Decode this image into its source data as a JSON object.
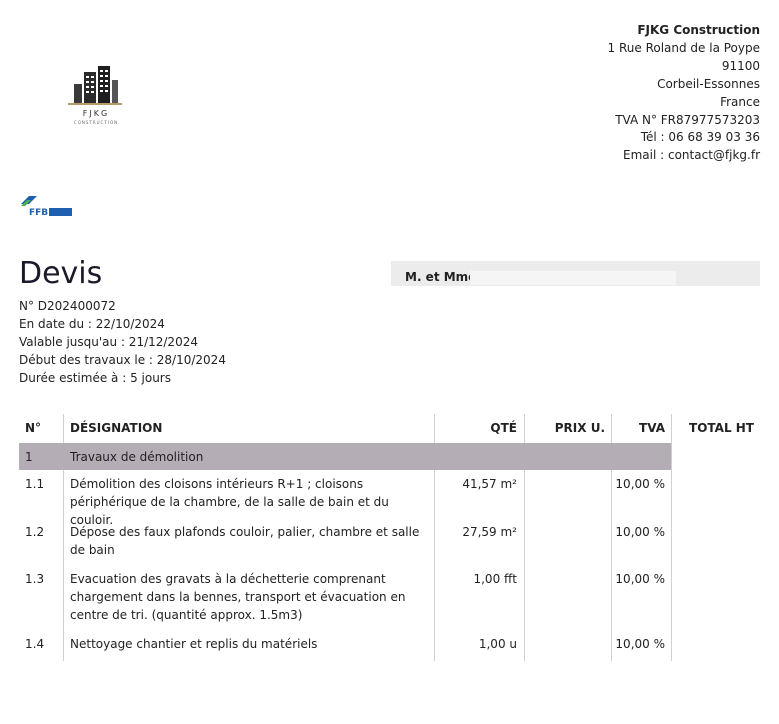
{
  "logo": {
    "name": "FJKG",
    "subtitle": "CONSTRUCTION"
  },
  "company": {
    "name": "FJKG Construction",
    "address": "1 Rue Roland de la Poype",
    "postcode": "91100",
    "city": "Corbeil-Essonnes",
    "country": "France",
    "vat": "TVA N° FR87977573203",
    "phone": "Tél : 06 68 39 03 36",
    "email": "Email : contact@fjkg.fr"
  },
  "badge": {
    "label": "FFB"
  },
  "document": {
    "title": "Devis",
    "number": "N° D202400072",
    "date": "En date du : 22/10/2024",
    "valid_until": "Valable jusqu'au : 21/12/2024",
    "start": "Début des travaux le : 28/10/2024",
    "duration": "Durée estimée à : 5 jours"
  },
  "client": {
    "label": "M. et Mme"
  },
  "table": {
    "headers": {
      "no": "N°",
      "designation": "DÉSIGNATION",
      "qty": "QTÉ",
      "unit_price": "PRIX U.",
      "vat": "TVA",
      "total": "TOTAL HT"
    },
    "section": {
      "no": "1",
      "label": "Travaux de démolition"
    },
    "rows": [
      {
        "no": "1.1",
        "designation": "Démolition des cloisons intérieurs R+1 ; cloisons périphérique de la chambre, de la salle de bain et du couloir.",
        "qty": "41,57 m²",
        "unit_price": "",
        "vat": "10,00 %"
      },
      {
        "no": "1.2",
        "designation": "Dépose des faux plafonds couloir, palier, chambre et salle de bain",
        "qty": "27,59 m²",
        "unit_price": "",
        "vat": "10,00 %"
      },
      {
        "no": "1.3",
        "designation": "Evacuation des gravats à la déchetterie comprenant chargement dans la bennes, transport et évacuation en centre de tri. (quantité approx. 1.5m3)",
        "qty": "1,00 fft",
        "unit_price": "",
        "vat": "10,00 %"
      },
      {
        "no": "1.4",
        "designation": "Nettoyage chantier et replis du matériels",
        "qty": "1,00 u",
        "unit_price": "",
        "vat": "10,00 %"
      }
    ]
  }
}
